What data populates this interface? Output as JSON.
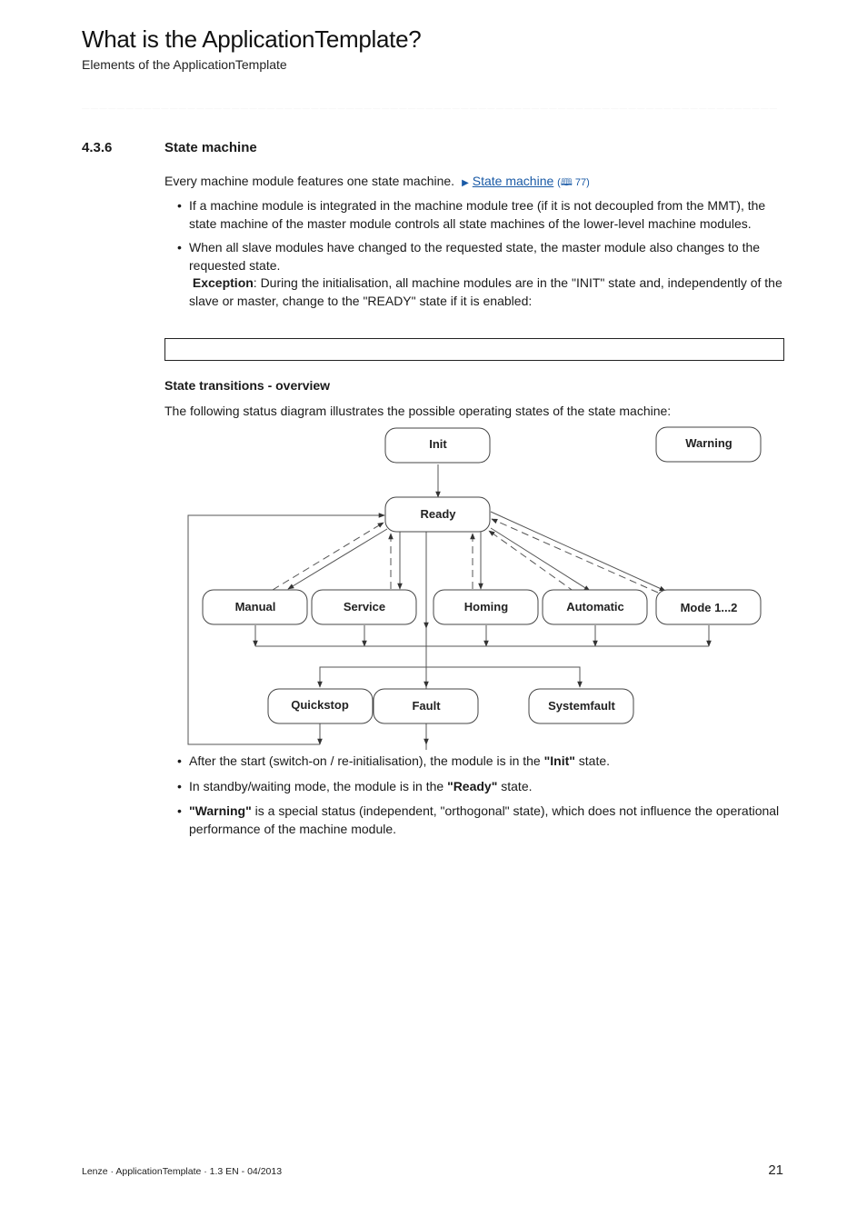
{
  "header": {
    "title": "What is the ApplicationTemplate?",
    "subtitle": "Elements of the ApplicationTemplate",
    "rule": "_______________________________________________________________________________"
  },
  "section": {
    "number": "4.3.6",
    "title": "State machine"
  },
  "intro": {
    "text": "Every machine module features one state machine.",
    "link_arrow_icon": "triangle-right-icon",
    "link_label": "State machine",
    "ref_prefix": "(",
    "ref_icon": "book-icon",
    "ref_glyph": "🕮",
    "ref_page": "77)"
  },
  "bullets_top": [
    {
      "text": "If a machine module is integrated in the machine module tree (if it is not decoupled from the MMT), the state machine of the master module controls all state machines of the lower-level machine modules."
    },
    {
      "text": "When all slave modules have changed to the requested state, the master module also changes to the requested state.",
      "exception_label": "Exception",
      "exception_text": ": During the initialisation, all machine modules are in the \"INIT\" state and, independently of the slave or master, change to the \"READY\" state if it is enabled:"
    }
  ],
  "subheading": "State transitions  - overview",
  "diagram_intro": "The following status diagram illustrates the possible operating states of the state machine:",
  "diagram": {
    "states": {
      "init": "Init",
      "warning": "Warning",
      "ready": "Ready",
      "manual": "Manual",
      "service": "Service",
      "homing": "Homing",
      "automatic": "Automatic",
      "mode": "Mode 1...2",
      "quickstop": "Quickstop",
      "fault": "Fault",
      "systemfault": "Systemfault"
    }
  },
  "bullets_bottom": [
    {
      "pre": "After the start (switch-on / re-initialisation), the module is in the ",
      "bold": "\"Init\"",
      "post": " state."
    },
    {
      "pre": "In standby/waiting mode, the module is in the ",
      "bold": "\"Ready\"",
      "post": " state."
    },
    {
      "pre": "",
      "bold": "\"Warning\"",
      "post": " is a special status (independent, \"orthogonal\" state), which does not influence the operational performance of the machine module."
    }
  ],
  "footer": {
    "left": "Lenze · ApplicationTemplate · 1.3 EN - 04/2013",
    "page": "21"
  }
}
